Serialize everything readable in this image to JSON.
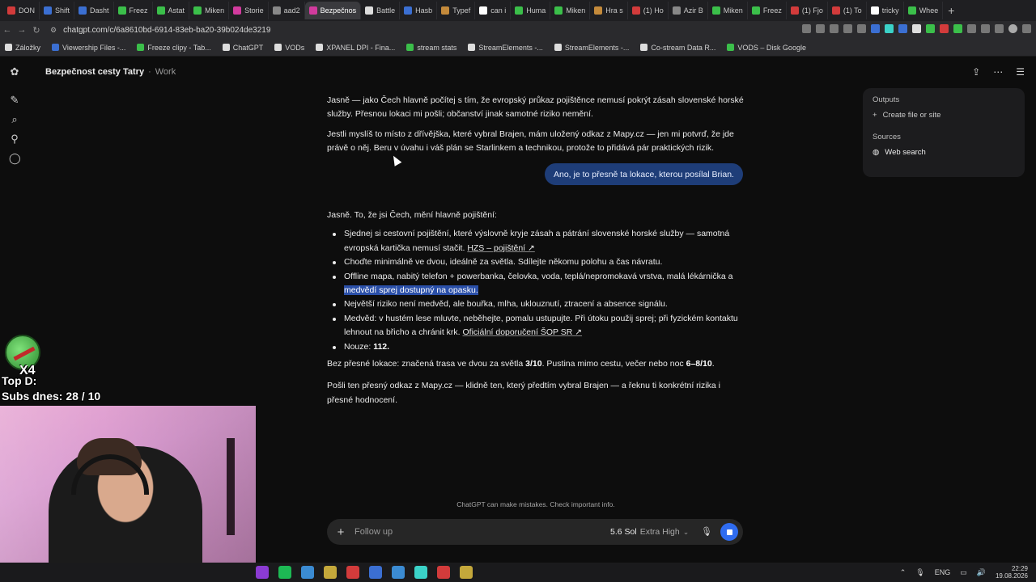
{
  "browser": {
    "tabs": [
      {
        "label": "DON",
        "color": "#d23b3b"
      },
      {
        "label": "Shift",
        "color": "#3b6fd2"
      },
      {
        "label": "Dasht",
        "color": "#3b6fd2"
      },
      {
        "label": "Freez",
        "color": "#3bbf4a"
      },
      {
        "label": "Astat",
        "color": "#3bbf4a"
      },
      {
        "label": "Miken",
        "color": "#3bbf4a"
      },
      {
        "label": "Storie",
        "color": "#d23b9e"
      },
      {
        "label": "aad2",
        "color": "#888888"
      },
      {
        "label": "Bezpečnos",
        "color": "#d23b9e",
        "active": true
      },
      {
        "label": "Battle",
        "color": "#dddddd"
      },
      {
        "label": "Hasb",
        "color": "#3b6fd2"
      },
      {
        "label": "Typef",
        "color": "#c48a3b"
      },
      {
        "label": "can i",
        "color": "#ffffff"
      },
      {
        "label": "Huma",
        "color": "#3bbf4a"
      },
      {
        "label": "Miken",
        "color": "#3bbf4a"
      },
      {
        "label": "Hra s",
        "color": "#c48a3b"
      },
      {
        "label": "(1) Ho",
        "color": "#d23b3b"
      },
      {
        "label": "Azir B",
        "color": "#888888"
      },
      {
        "label": "Miken",
        "color": "#3bbf4a"
      },
      {
        "label": "Freez",
        "color": "#3bbf4a"
      },
      {
        "label": "(1) Fjo",
        "color": "#d23b3b"
      },
      {
        "label": "(1) To",
        "color": "#d23b3b"
      },
      {
        "label": "tricky",
        "color": "#ffffff"
      },
      {
        "label": "Whee",
        "color": "#3bbf4a"
      }
    ],
    "new_tab": "+",
    "url": "chatgpt.com/c/6a8610bd-6914-83eb-ba20-39b024de3219",
    "bookmarks": [
      {
        "label": "Záložky",
        "color": "#dddddd"
      },
      {
        "label": "Viewership Files -...",
        "color": "#3b6fd2"
      },
      {
        "label": "Freeze clipy - Tab...",
        "color": "#3bbf4a"
      },
      {
        "label": "ChatGPT",
        "color": "#dddddd"
      },
      {
        "label": "VODs",
        "color": "#dddddd"
      },
      {
        "label": "XPANEL DPI - Fina...",
        "color": "#dddddd"
      },
      {
        "label": "stream stats",
        "color": "#3bbf4a"
      },
      {
        "label": "StreamElements -...",
        "color": "#dddddd"
      },
      {
        "label": "StreamElements -...",
        "color": "#dddddd"
      },
      {
        "label": "Co-stream Data R...",
        "color": "#dddddd"
      },
      {
        "label": "VODS – Disk Google",
        "color": "#3bbf4a"
      }
    ]
  },
  "header": {
    "title": "Bezpečnost cesty Tatry",
    "separator": "·",
    "project": "Work"
  },
  "messages": {
    "prev_p1": "Jasně — jako Čech hlavně počítej s tím, že evropský průkaz pojištěnce nemusí pokrýt zásah slovenské horské služby. Přesnou lokaci mi pošli; občanství jinak samotné riziko nemění.",
    "prev_p2": "Jestli myslíš to místo z dřívějška, které vybral Brajen, mám uložený odkaz z Mapy.cz — jen mi potvrď, že jde právě o něj. Beru v úvahu i váš plán se Starlinkem a technikou, protože to přidává pár praktických rizik.",
    "user_msg": "Ano, je to přesně ta lokace, kterou posílal Brian.",
    "intro": "Jasně. To, že jsi Čech, mění hlavně pojištění:",
    "b1_text": "Sjednej si cestovní pojištění, které výslovně kryje zásah a pátrání slovenské horské služby — samotná evropská kartička nemusí stačit.",
    "b1_link": "HZS – pojištění ↗",
    "b2_text": "Choďte minimálně ve dvou, ideálně za světla. Sdílejte někomu polohu a čas návratu.",
    "b3_text": "Offline mapa, nabitý telefon + powerbanka, čelovka, voda, teplá/nepromokavá vrstva, malá lékárnička a",
    "b3_highlight": "medvědí sprej dostupný na opasku.",
    "b4_text": "Největší riziko není medvěd, ale bouřka, mlha, uklouznutí, ztracení a absence signálu.",
    "b5_text": "Medvěd: v hustém lese mluvte, neběhejte, pomalu ustupujte. Při útoku použij sprej; při fyzickém kontaktu lehnout na břicho a chránit krk.",
    "b5_link": "Oficiální doporučení ŠOP SR ↗",
    "b6_label": "Nouze:",
    "b6_value": "112.",
    "p_loc_a": "Bez přesné lokace: značená trasa ve dvou za světla",
    "p_loc_b": "3/10",
    "p_loc_c": ". Pustina mimo cestu, večer nebo noc",
    "p_loc_d": "6–8/10",
    "p_loc_e": ".",
    "p_last": "Pošli ten přesný odkaz z Mapy.cz — klidně ten, který předtím vybral Brajen — a řeknu ti konkrétní rizika i přesné hodnocení."
  },
  "side_panel": {
    "outputs_label": "Outputs",
    "create_label": "Create file or site",
    "sources_label": "Sources",
    "web_search_label": "Web search"
  },
  "composer": {
    "disclaimer": "ChatGPT can make mistakes. Check important info.",
    "placeholder": "Follow up",
    "model_name": "5.6 Sol",
    "model_level": "Extra High"
  },
  "overlay": {
    "badge": "X4",
    "top_donor": "Top D:",
    "subs": "Subs dnes: 28 / 10"
  },
  "taskbar": {
    "lang": "ENG",
    "time": "22:29",
    "date": "19.08.2026",
    "icons": [
      "#8b3bd2",
      "#1db954",
      "#3b8bd2",
      "#c4a83b",
      "#d23b3b",
      "#3b6fd2",
      "#3b8bd2",
      "#3bd2c8",
      "#d23b3b",
      "#c4a83b"
    ]
  },
  "colors": {
    "accent": "#2f6cf0",
    "user_bubble": "#1e3d78",
    "highlight": "#2a4fa8"
  }
}
